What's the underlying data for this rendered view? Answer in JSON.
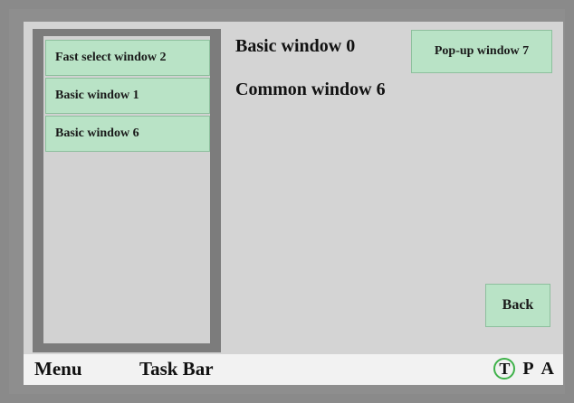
{
  "sidebar": {
    "items": [
      {
        "label": "Fast select window 2"
      },
      {
        "label": "Basic window 1"
      },
      {
        "label": "Basic window 6"
      }
    ]
  },
  "main": {
    "title_basic": "Basic window 0",
    "title_common": "Common window 6",
    "popup_button": "Pop-up window 7",
    "back_button": "Back"
  },
  "taskbar": {
    "menu": "Menu",
    "task_bar": "Task Bar",
    "indicators": {
      "t": "T",
      "p": "P",
      "a": "A"
    }
  },
  "colors": {
    "button_green": "#b9e3c6",
    "indicator_ring": "#3fb24a"
  }
}
